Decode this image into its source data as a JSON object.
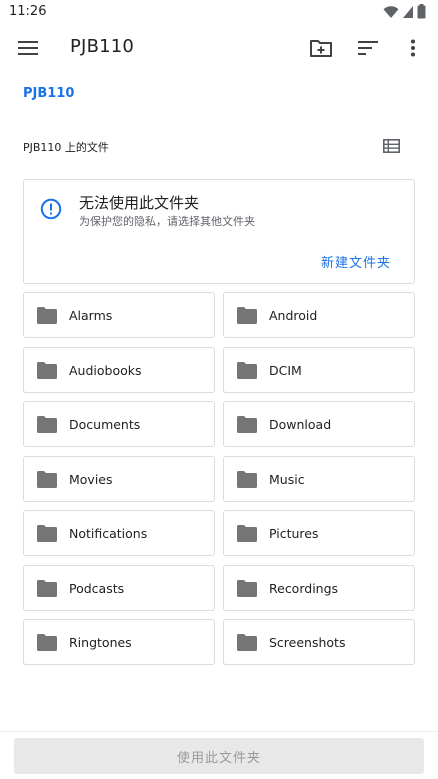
{
  "status_bar": {
    "time": "11:26",
    "icons": [
      "wifi-icon",
      "cellular-signal-icon",
      "battery-icon"
    ]
  },
  "app_bar": {
    "title": "PJB110",
    "actions": [
      "new-folder-icon",
      "sort-icon",
      "more-vert-icon"
    ]
  },
  "breadcrumb": "PJB110",
  "section": {
    "title": "PJB110 上的文件"
  },
  "warning_card": {
    "title": "无法使用此文件夹",
    "subtitle": "为保护您的隐私，请选择其他文件夹",
    "action": "新建文件夹"
  },
  "folders": [
    "Alarms",
    "Android",
    "Audiobooks",
    "DCIM",
    "Documents",
    "Download",
    "Movies",
    "Music",
    "Notifications",
    "Pictures",
    "Podcasts",
    "Recordings",
    "Ringtones",
    "Screenshots"
  ],
  "bottom_button": "使用此文件夹",
  "colors": {
    "accent": "#1a73e8",
    "folder_icon": "#757575",
    "border": "#dadce0",
    "disabled_button_bg": "#e8e8e8",
    "disabled_button_text": "#9a9a9a"
  }
}
